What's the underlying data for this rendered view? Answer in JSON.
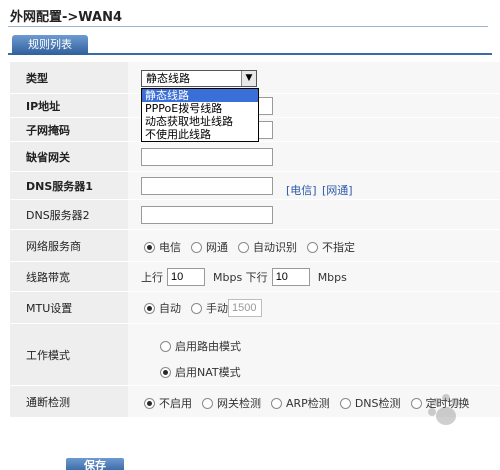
{
  "header": {
    "title": "外网配置->WAN4"
  },
  "tabs": {
    "rules_list": "规则列表"
  },
  "form": {
    "type": {
      "label": "类型",
      "value": "静态线路"
    },
    "type_options": [
      "静态线路",
      "PPPoE拨号线路",
      "动态获取地址线路",
      "不使用此线路"
    ],
    "ip": {
      "label": "IP地址",
      "value": ""
    },
    "subnet": {
      "label": "子网掩码",
      "value": ""
    },
    "gateway": {
      "label": "缺省网关",
      "value": ""
    },
    "dns1": {
      "label": "DNS服务器1",
      "value": "",
      "link_telecom": "[电信]",
      "link_netcom": "[网通]"
    },
    "dns2": {
      "label": "DNS服务器2",
      "value": ""
    },
    "isp": {
      "label": "网络服务商",
      "options": [
        "电信",
        "网通",
        "自动识别",
        "不指定"
      ],
      "selected": "电信"
    },
    "bandwidth": {
      "label": "线路带宽",
      "up_label": "上行",
      "up_value": "10",
      "down_label": "Mbps 下行",
      "down_value": "10",
      "unit": "Mbps"
    },
    "mtu": {
      "label": "MTU设置",
      "auto": "自动",
      "manual": "手动",
      "value": "1500",
      "selected": "自动"
    },
    "work_mode": {
      "label": "工作模式",
      "route": "启用路由模式",
      "nat": "启用NAT模式",
      "selected": "启用NAT模式"
    },
    "link_check": {
      "label": "通断检测",
      "options": [
        "不启用",
        "网关检测",
        "ARP检测",
        "DNS检测",
        "定时切换"
      ],
      "selected": "不启用"
    }
  },
  "buttons": {
    "save": "保存"
  },
  "colors": {
    "accent": "#3b6ca7",
    "label_bg": "#eeeeee",
    "field_bg": "#f7f7f7",
    "link": "#2b5aa8"
  }
}
